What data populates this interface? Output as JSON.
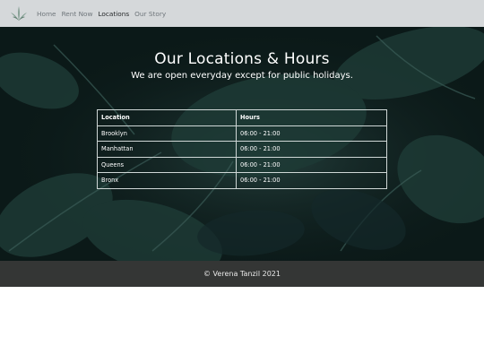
{
  "nav": {
    "logo_icon": "leaf-plant-icon",
    "links": [
      {
        "label": "Home",
        "active": false
      },
      {
        "label": "Rent Now",
        "active": false
      },
      {
        "label": "Locations",
        "active": true
      },
      {
        "label": "Our Story",
        "active": false
      }
    ]
  },
  "hero": {
    "title": "Our Locations & Hours",
    "subtitle": "We are open everyday except for public holidays."
  },
  "table": {
    "headers": [
      "Location",
      "Hours"
    ],
    "rows": [
      [
        "Brooklyn",
        "06:00 - 21:00"
      ],
      [
        "Manhattan",
        "06:00 - 21:00"
      ],
      [
        "Queens",
        "06:00 - 21:00"
      ],
      [
        "Bronx",
        "06:00 - 21:00"
      ]
    ]
  },
  "footer": {
    "text": "© Verena Tanzil 2021"
  },
  "colors": {
    "navbar_bg": "#d5d8da",
    "hero_bg": "#0b1918",
    "footer_bg": "#343635"
  }
}
